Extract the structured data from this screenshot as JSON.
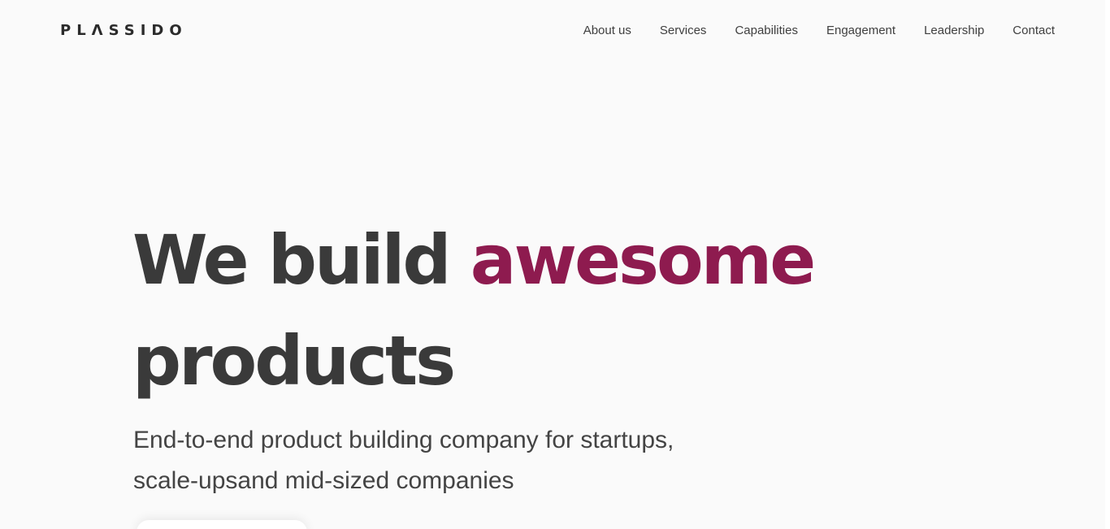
{
  "header": {
    "logo": "PLΛSSIDO",
    "nav": [
      {
        "label": "About us"
      },
      {
        "label": "Services"
      },
      {
        "label": "Capabilities"
      },
      {
        "label": "Engagement"
      },
      {
        "label": "Leadership"
      },
      {
        "label": "Contact"
      }
    ]
  },
  "hero": {
    "title_part1": "We build ",
    "title_accent": "awesome",
    "title_part2": "products",
    "subtitle_line1": "End-to-end product building company for startups,",
    "subtitle_line2": "scale-upsand mid-sized companies"
  },
  "colors": {
    "accent": "#8e1b4f",
    "text": "#3a3a3a",
    "background": "#fafafa"
  }
}
